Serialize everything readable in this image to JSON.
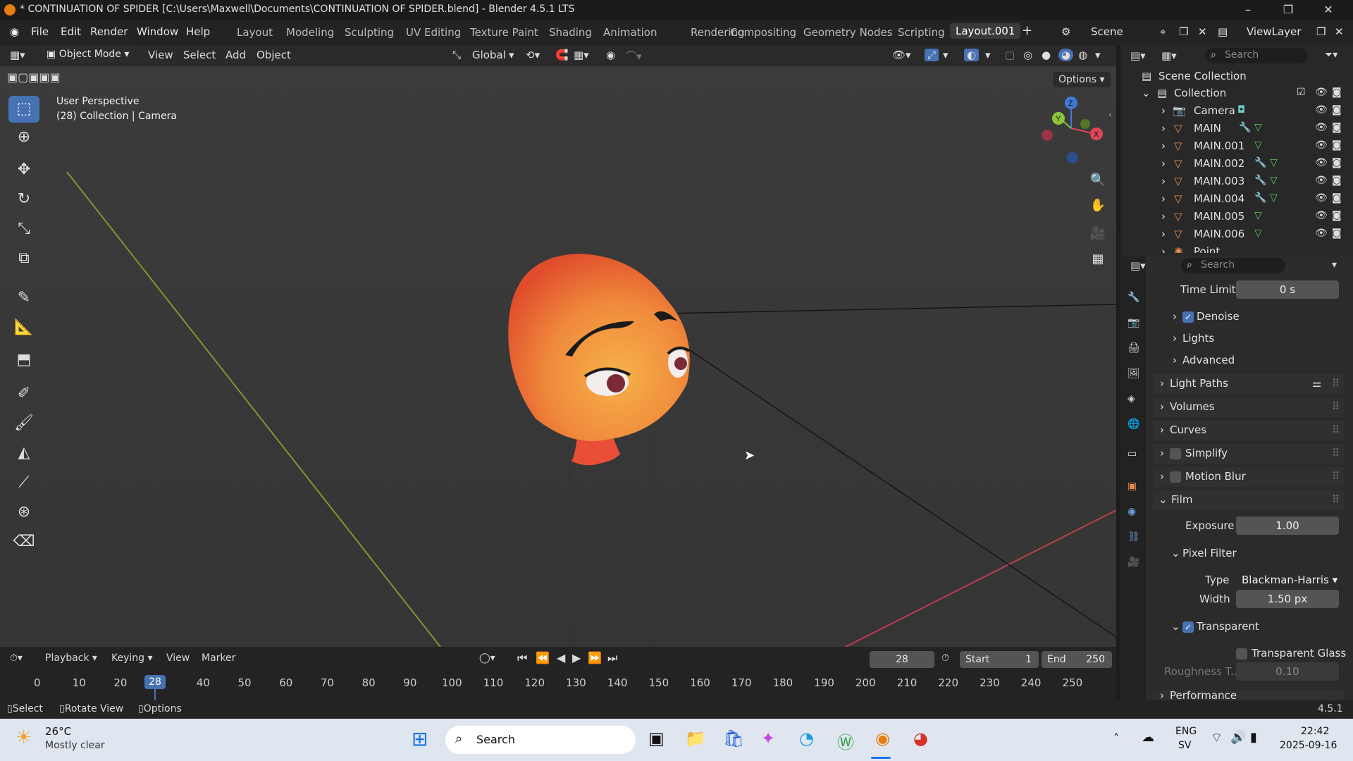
{
  "window": {
    "title": "* CONTINUATION OF SPIDER [C:\\Users\\Maxwell\\Documents\\CONTINUATION OF SPIDER.blend] - Blender 4.5.1 LTS"
  },
  "menu": {
    "items": [
      "File",
      "Edit",
      "Render",
      "Window",
      "Help"
    ],
    "workspaces": [
      "Layout",
      "Modeling",
      "Sculpting",
      "UV Editing",
      "Texture Paint",
      "Shading",
      "Animation",
      "Rendering",
      "Compositing",
      "Geometry Nodes",
      "Scripting",
      "Layout.001"
    ],
    "scene": "Scene",
    "view_layer": "ViewLayer"
  },
  "viewport_header": {
    "mode": "Object Mode",
    "menus": [
      "View",
      "Select",
      "Add",
      "Object"
    ],
    "orientation": "Global",
    "options": "Options"
  },
  "viewport": {
    "perspective": "User Perspective",
    "context": "(28) Collection | Camera",
    "gizmo": {
      "x": "X",
      "y": "Y",
      "z": "Z"
    }
  },
  "outliner": {
    "search_placeholder": "Search",
    "scene_collection": "Scene Collection",
    "collection": "Collection",
    "items": [
      "Camera",
      "MAIN",
      "MAIN.001",
      "MAIN.002",
      "MAIN.003",
      "MAIN.004",
      "MAIN.005",
      "MAIN.006",
      "Point"
    ]
  },
  "properties": {
    "search_placeholder": "Search",
    "time_limit_label": "Time Limit",
    "time_limit_value": "0 s",
    "denoise": "Denoise",
    "lights": "Lights",
    "advanced": "Advanced",
    "light_paths": "Light Paths",
    "volumes": "Volumes",
    "curves": "Curves",
    "simplify": "Simplify",
    "motion_blur": "Motion Blur",
    "film": "Film",
    "exposure_label": "Exposure",
    "exposure_value": "1.00",
    "pixel_filter": "Pixel Filter",
    "type_label": "Type",
    "type_value": "Blackman-Harris",
    "width_label": "Width",
    "width_value": "1.50 px",
    "transparent": "Transparent",
    "transparent_glass": "Transparent Glass",
    "roughness_label": "Roughness T...",
    "roughness_value": "0.10",
    "performance": "Performance"
  },
  "timeline": {
    "menus": [
      "Playback",
      "Keying",
      "View",
      "Marker"
    ],
    "current_frame": "28",
    "start_label": "Start",
    "start_value": "1",
    "end_label": "End",
    "end_value": "250",
    "ticks": [
      "0",
      "10",
      "20",
      "28",
      "40",
      "50",
      "60",
      "70",
      "80",
      "90",
      "100",
      "110",
      "120",
      "130",
      "140",
      "150",
      "160",
      "170",
      "180",
      "190",
      "200",
      "210",
      "220",
      "230",
      "240",
      "250"
    ]
  },
  "statusbar": {
    "select": "Select",
    "rotate": "Rotate View",
    "options": "Options",
    "version": "4.5.1"
  },
  "taskbar": {
    "weather_temp": "26°C",
    "weather_desc": "Mostly clear",
    "search": "Search",
    "lang": "ENG",
    "lang_sub": "SV",
    "time": "22:42",
    "date": "2025-09-16"
  },
  "colors": {
    "accent": "#4772b3",
    "blender_orange": "#e87d0d",
    "x_axis": "#e0455a",
    "y_axis": "#8cc43b",
    "z_axis": "#3f79d8"
  }
}
